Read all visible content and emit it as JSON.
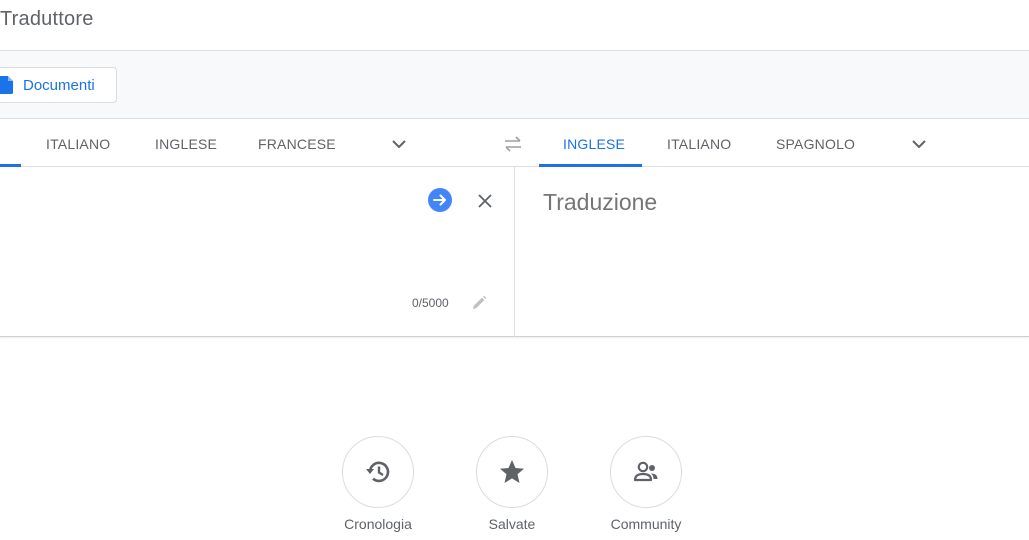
{
  "header": {
    "title": "Traduttore"
  },
  "mode_bar": {
    "documents_label": "Documenti"
  },
  "source_languages": [
    {
      "label": "ITALIANO"
    },
    {
      "label": "INGLESE"
    },
    {
      "label": "FRANCESE"
    }
  ],
  "target_languages": [
    {
      "label": "INGLESE",
      "active": true
    },
    {
      "label": "ITALIANO"
    },
    {
      "label": "SPAGNOLO"
    }
  ],
  "source_panel": {
    "char_count": "0/5000"
  },
  "target_panel": {
    "placeholder": "Traduzione"
  },
  "bottom_nav": [
    {
      "label": "Cronologia",
      "icon": "history-icon"
    },
    {
      "label": "Salvate",
      "icon": "star-icon"
    },
    {
      "label": "Community",
      "icon": "community-icon"
    }
  ],
  "colors": {
    "accent": "#1a73e8",
    "translate_button": "#4285f4",
    "text_muted": "#5f6368"
  }
}
